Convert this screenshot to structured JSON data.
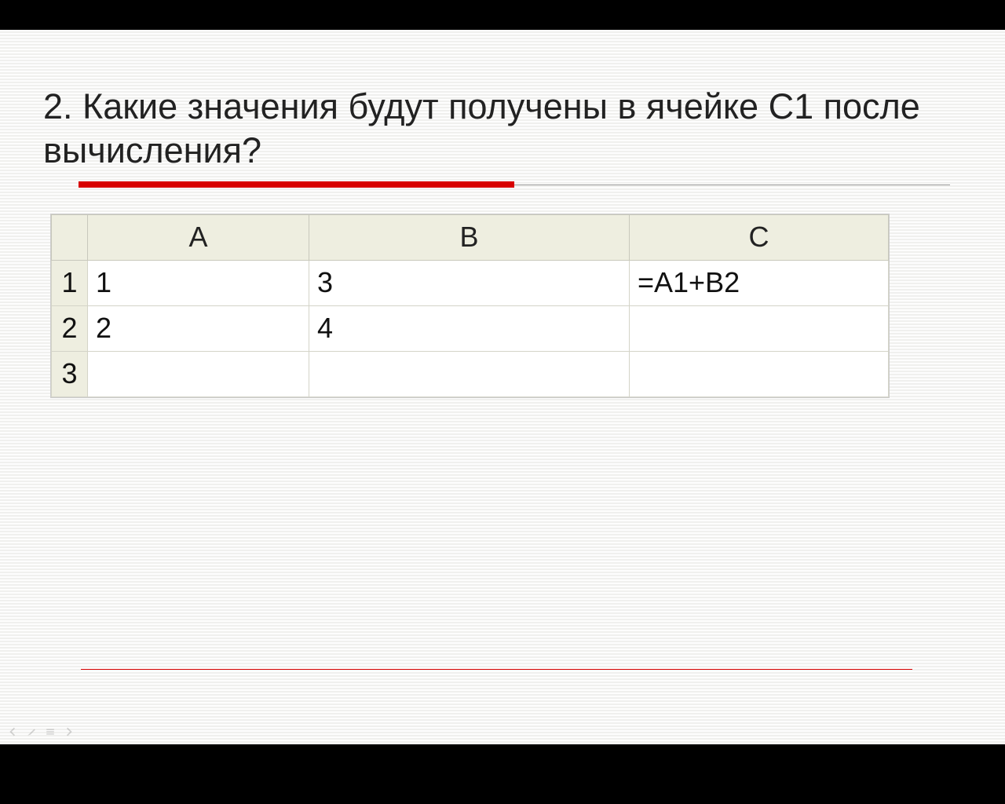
{
  "question": {
    "title": "2. Какие значения будут получены в ячейке С1 после вычисления?"
  },
  "table": {
    "columns": [
      "A",
      "B",
      "C"
    ],
    "rows": [
      {
        "num": "1",
        "a": "1",
        "b": "3",
        "c": "=A1+B2"
      },
      {
        "num": "2",
        "a": "2",
        "b": "4",
        "c": ""
      },
      {
        "num": "3",
        "a": "",
        "b": "",
        "c": ""
      }
    ]
  }
}
